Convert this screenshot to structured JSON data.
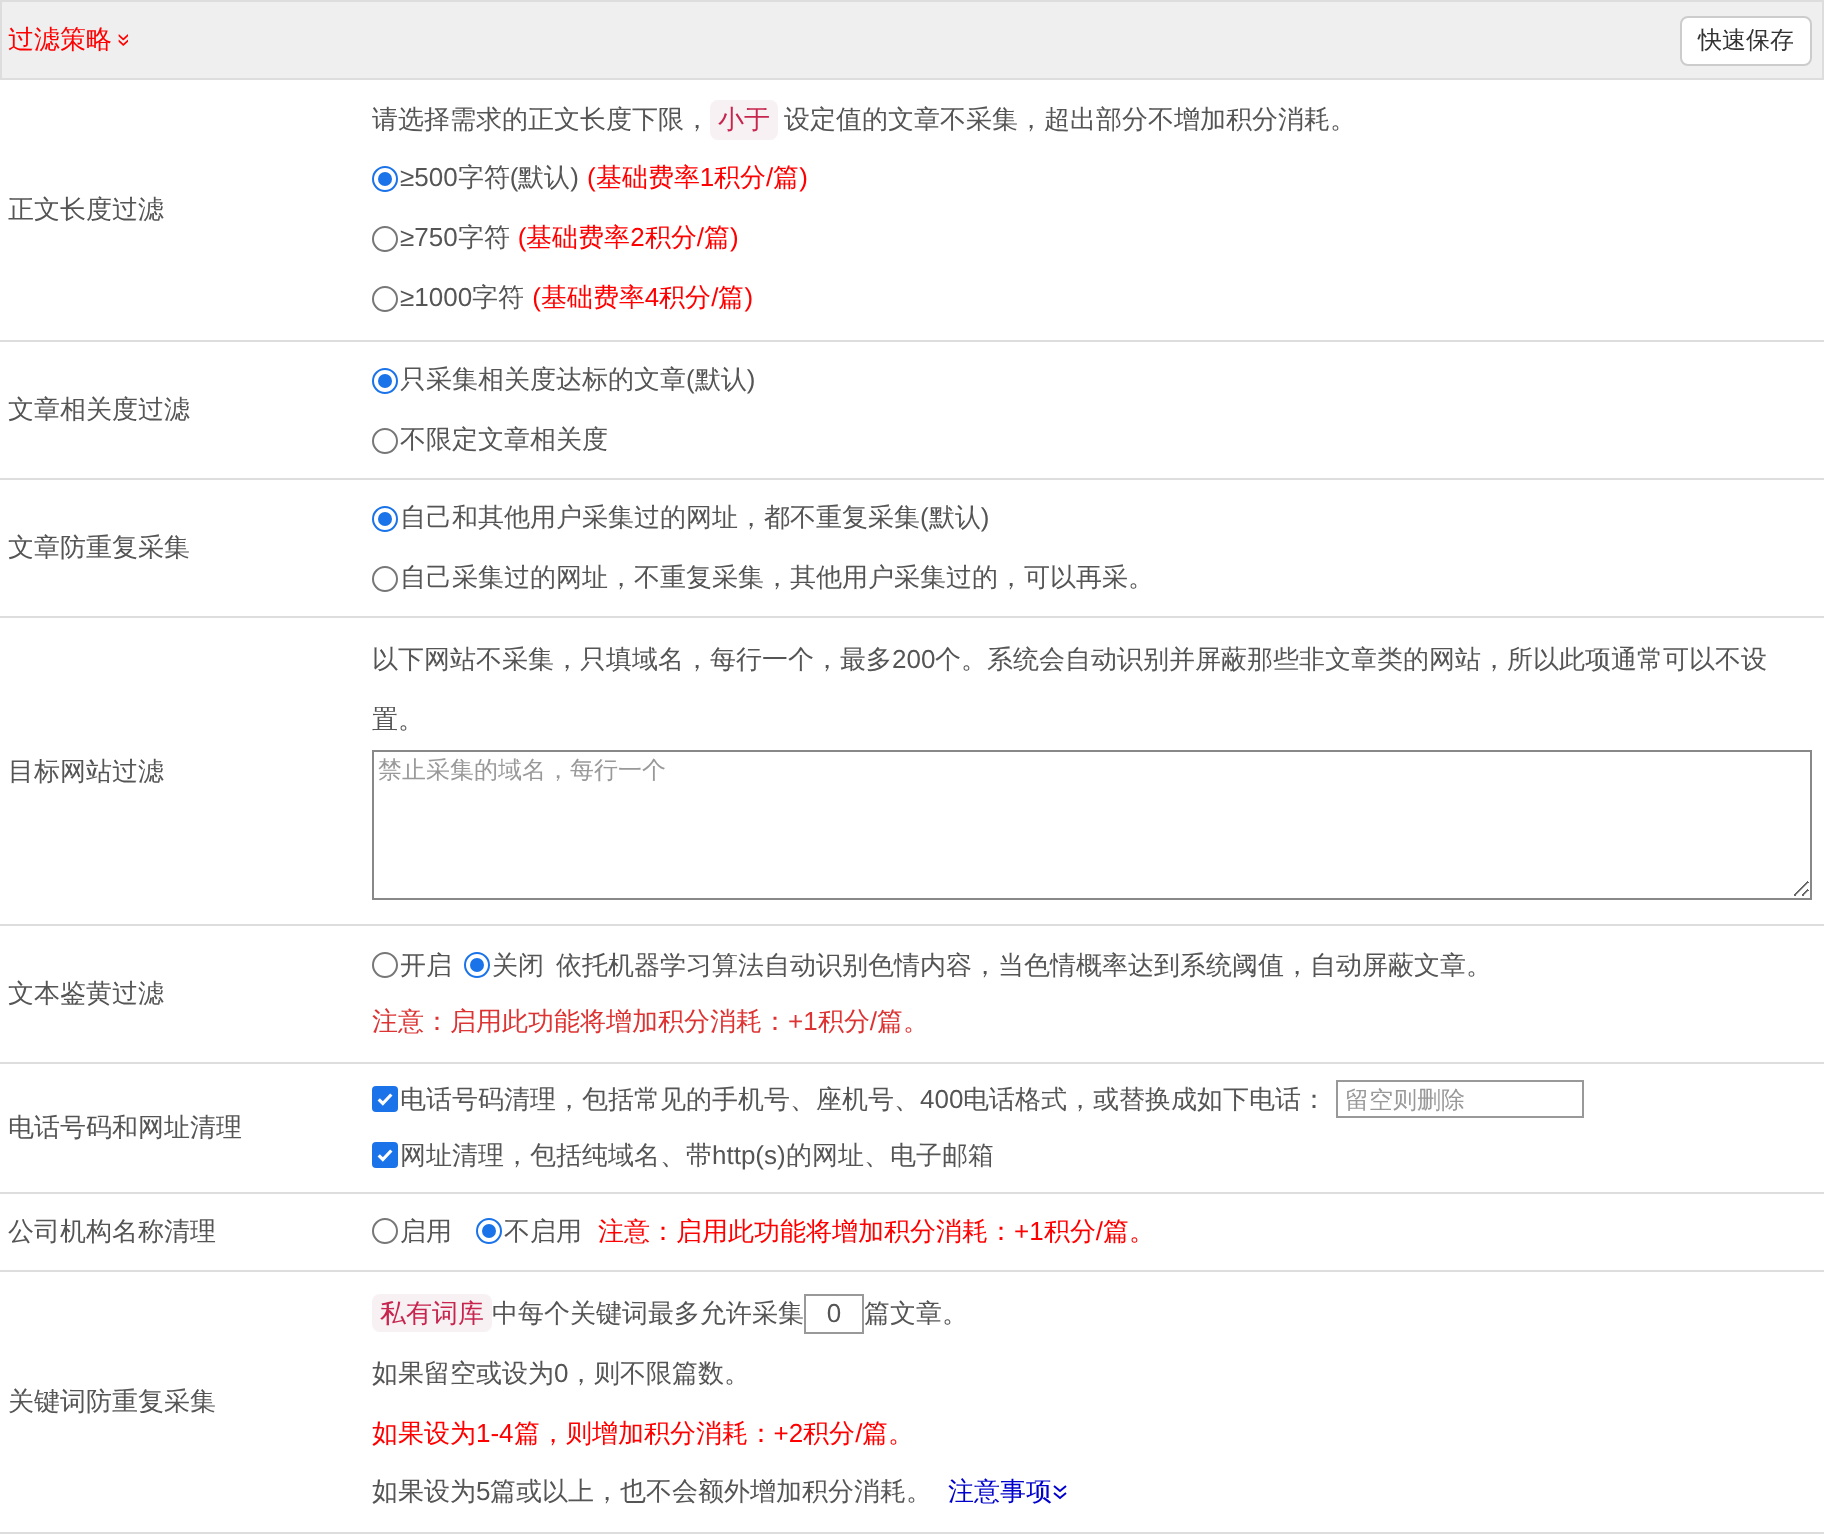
{
  "header": {
    "title": "过滤策略",
    "toggle": "»",
    "save_button": "快速保存"
  },
  "rows": [
    {
      "kind": "length",
      "label": "正文长度过滤",
      "intro": {
        "before": "请选择需求的正文长度下限，",
        "tag": "小于",
        "after": "设定值的文章不采集，超出部分不增加积分消耗。"
      },
      "options": [
        {
          "text": "≥500字符(默认)",
          "note": "(基础费率1积分/篇)",
          "selected": true
        },
        {
          "text": "≥750字符",
          "note": "(基础费率2积分/篇)",
          "selected": false
        },
        {
          "text": "≥1000字符",
          "note": "(基础费率4积分/篇)",
          "selected": false
        }
      ]
    },
    {
      "kind": "radios",
      "label": "文章相关度过滤",
      "options": [
        {
          "text": "只采集相关度达标的文章(默认)",
          "selected": true
        },
        {
          "text": "不限定文章相关度",
          "selected": false
        }
      ]
    },
    {
      "kind": "radios",
      "label": "文章防重复采集",
      "options": [
        {
          "text": "自己和其他用户采集过的网址，都不重复采集(默认)",
          "selected": true
        },
        {
          "text": "自己采集过的网址，不重复采集，其他用户采集过的，可以再采。",
          "selected": false
        }
      ]
    },
    {
      "kind": "textarea",
      "label": "目标网站过滤",
      "intro": "以下网站不采集，只填域名，每行一个，最多200个。系统会自动识别并屏蔽那些非文章类的网站，所以此项通常可以不设置。",
      "placeholder": "禁止采集的域名，每行一个"
    },
    {
      "kind": "toggle",
      "label": "文本鉴黄过滤",
      "options": [
        {
          "text": "开启",
          "selected": false
        },
        {
          "text": "关闭",
          "selected": true
        }
      ],
      "description": "依托机器学习算法自动识别色情内容，当色情概率达到系统阈值，自动屏蔽文章。",
      "warning": "注意：启用此功能将增加积分消耗：+1积分/篇。"
    },
    {
      "kind": "checks",
      "label": "电话号码和网址清理",
      "items": [
        {
          "text": "电话号码清理，包括常见的手机号、座机号、400电话格式，或替换成如下电话：",
          "checked": true,
          "placeholder": "留空则删除"
        },
        {
          "text": "网址清理，包括纯域名、带http(s)的网址、电子邮箱",
          "checked": true
        }
      ]
    },
    {
      "kind": "inline",
      "label": "公司机构名称清理",
      "options": [
        {
          "text": "启用",
          "selected": false
        },
        {
          "text": "不启用",
          "selected": true
        }
      ],
      "warning": "注意：启用此功能将增加积分消耗：+1积分/篇。"
    },
    {
      "kind": "keyword",
      "label": "关键词防重复采集",
      "tag": "私有词库",
      "before": "中每个关键词最多允许采集",
      "value": "0",
      "after": "篇文章。",
      "lines": [
        "如果留空或设为0，则不限篇数。"
      ],
      "warning": "如果设为1-4篇，则增加积分消耗：+2积分/篇。",
      "last": "如果设为5篇或以上，也不会额外增加积分消耗。",
      "link": "注意事项"
    }
  ]
}
